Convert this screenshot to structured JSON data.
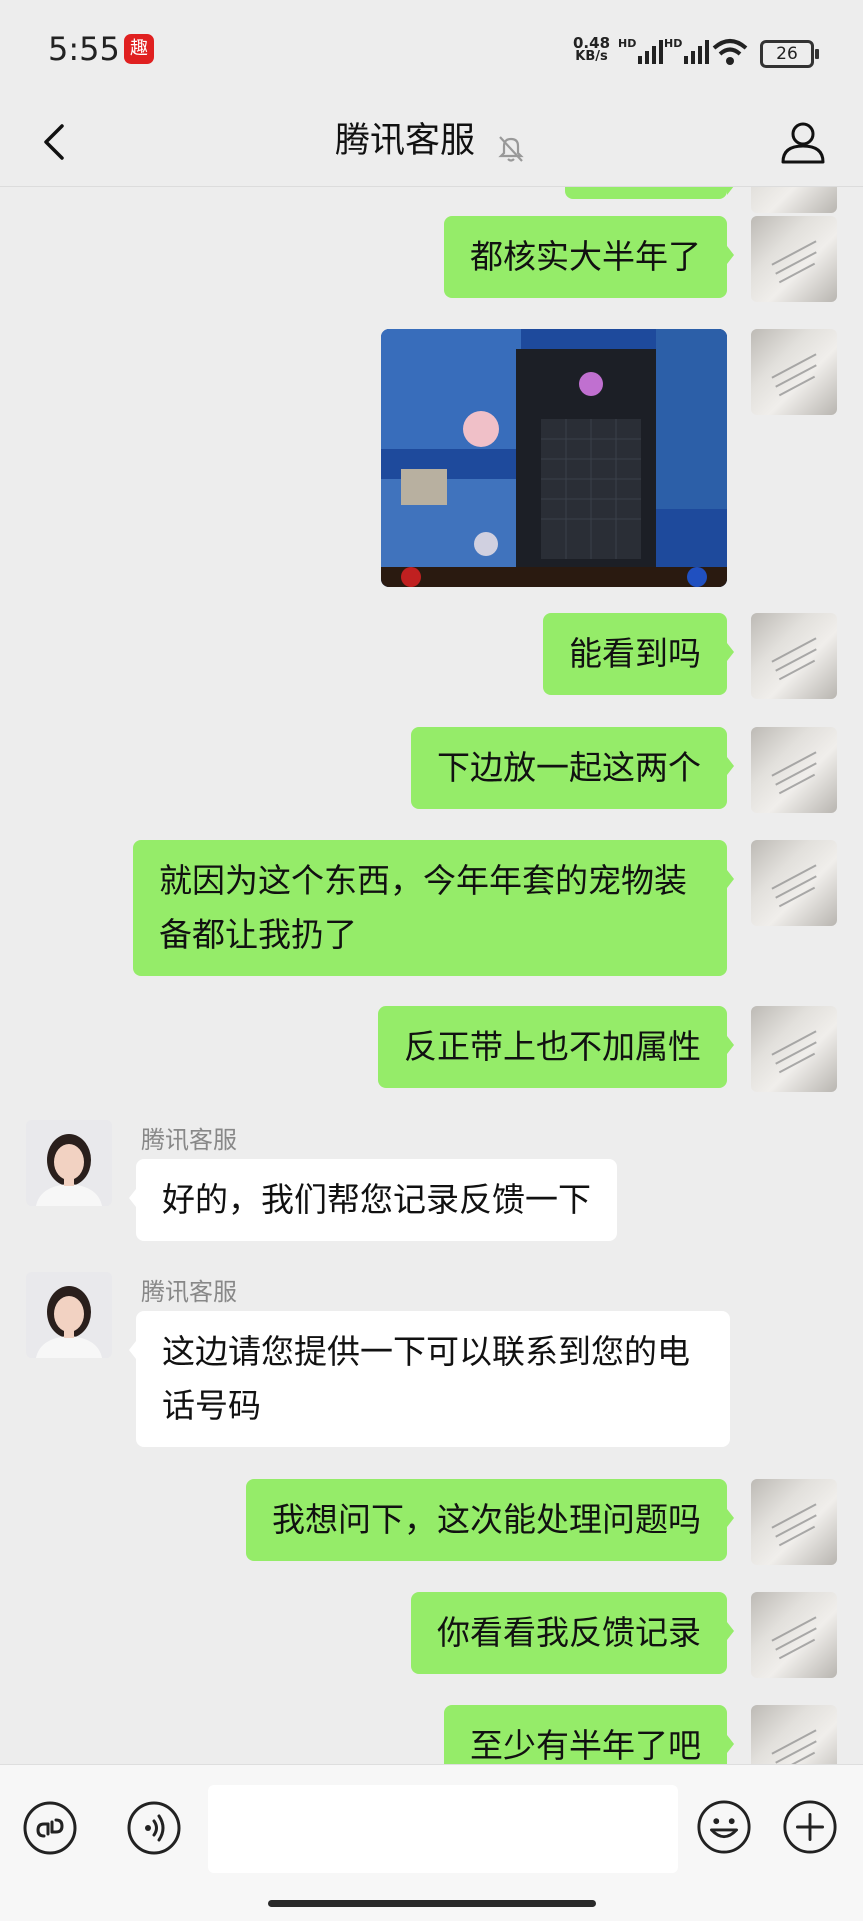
{
  "status_bar": {
    "time": "5:55",
    "app_badge_label": "趣",
    "net_speed_value": "0.48",
    "net_speed_unit": "KB/s",
    "sim1_label": "HD",
    "sim2_label": "HD",
    "battery_level": "26"
  },
  "header": {
    "title": "腾讯客服",
    "back_icon": "chevron-left-icon",
    "mute_icon": "bell-off-icon",
    "profile_icon": "person-icon"
  },
  "messages": [
    {
      "from": "me",
      "type": "text",
      "text": "都核实大半年了"
    },
    {
      "from": "me",
      "type": "image",
      "text": ""
    },
    {
      "from": "me",
      "type": "text",
      "text": "能看到吗"
    },
    {
      "from": "me",
      "type": "text",
      "text": "下边放一起这两个"
    },
    {
      "from": "me",
      "type": "text",
      "text": "就因为这个东西，今年年套的宠物装备都让我扔了"
    },
    {
      "from": "me",
      "type": "text",
      "text": "反正带上也不加属性"
    },
    {
      "from": "cs",
      "type": "text",
      "sender": "腾讯客服",
      "text": "好的，我们帮您记录反馈一下"
    },
    {
      "from": "cs",
      "type": "text",
      "sender": "腾讯客服",
      "text": "这边请您提供一下可以联系到您的电话号码"
    },
    {
      "from": "me",
      "type": "text",
      "text": "我想问下，这次能处理问题吗"
    },
    {
      "from": "me",
      "type": "text",
      "text": "你看看我反馈记录"
    },
    {
      "from": "me",
      "type": "text",
      "text": "至少有半年了吧"
    }
  ],
  "input_bar": {
    "left_icons": [
      "mini-program-icon",
      "voice-icon"
    ],
    "right_icons": [
      "emoji-icon",
      "plus-icon"
    ],
    "text_value": ""
  },
  "colors": {
    "my_bubble": "#95ec69",
    "cs_bubble": "#ffffff",
    "background": "#ededed"
  }
}
